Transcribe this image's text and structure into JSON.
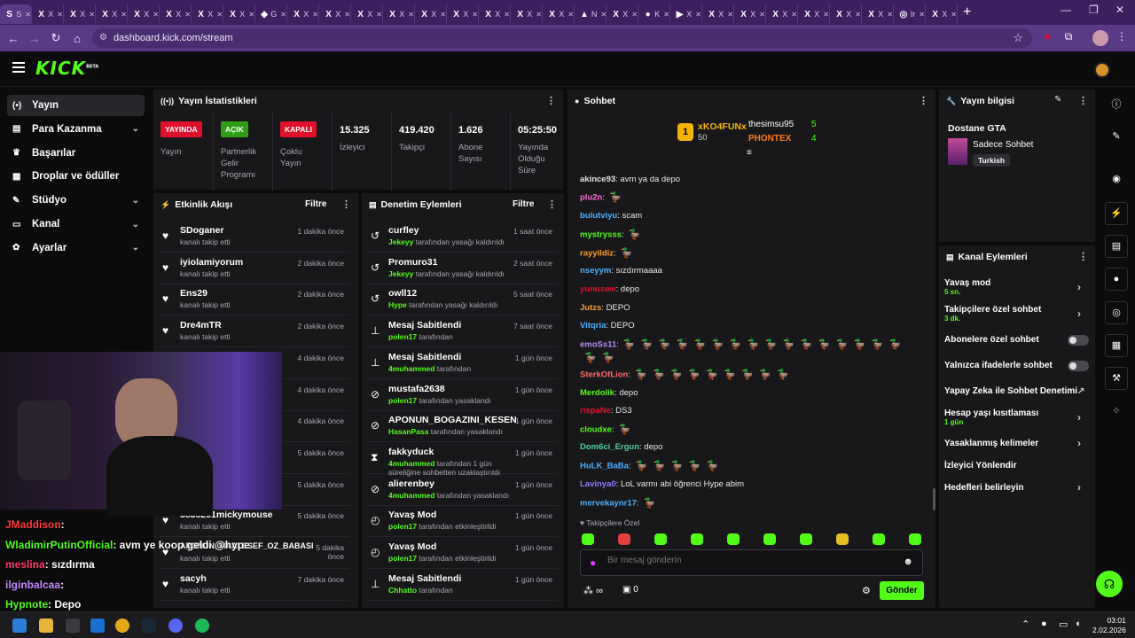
{
  "browser": {
    "tabs": [
      {
        "label": "S",
        "icon": "S"
      },
      {
        "label": "X",
        "icon": "X"
      },
      {
        "label": "X",
        "icon": "X"
      },
      {
        "label": "X",
        "icon": "X"
      },
      {
        "label": "X",
        "icon": "X"
      },
      {
        "label": "X",
        "icon": "X"
      },
      {
        "label": "X",
        "icon": "X"
      },
      {
        "label": "X",
        "icon": "X"
      },
      {
        "label": "G",
        "icon": "◆"
      },
      {
        "label": "X",
        "icon": "X"
      },
      {
        "label": "X",
        "icon": "X"
      },
      {
        "label": "X",
        "icon": "X"
      },
      {
        "label": "X",
        "icon": "X"
      },
      {
        "label": "X",
        "icon": "X"
      },
      {
        "label": "X",
        "icon": "X"
      },
      {
        "label": "X",
        "icon": "X"
      },
      {
        "label": "X",
        "icon": "X"
      },
      {
        "label": "X",
        "icon": "X"
      },
      {
        "label": "N",
        "icon": "▲"
      },
      {
        "label": "X",
        "icon": "X"
      },
      {
        "label": "K",
        "icon": "●"
      },
      {
        "label": "X",
        "icon": "▶"
      },
      {
        "label": "X",
        "icon": "X"
      },
      {
        "label": "X",
        "icon": "X"
      },
      {
        "label": "X",
        "icon": "X"
      },
      {
        "label": "X",
        "icon": "X"
      },
      {
        "label": "X",
        "icon": "X"
      },
      {
        "label": "X",
        "icon": "X"
      },
      {
        "label": "Ir",
        "icon": "◎"
      },
      {
        "label": "X",
        "icon": "X"
      }
    ],
    "url": "dashboard.kick.com/stream"
  },
  "brand": {
    "logo": "KICK",
    "beta": "BETA"
  },
  "sidebar": [
    {
      "label": "Yayın",
      "icon": "(•)",
      "active": true
    },
    {
      "label": "Para Kazanma",
      "icon": "▤",
      "chev": true
    },
    {
      "label": "Başarılar",
      "icon": "♛"
    },
    {
      "label": "Droplar ve ödüller",
      "icon": "▦"
    },
    {
      "label": "Stüdyo",
      "icon": "✎",
      "chev": true
    },
    {
      "label": "Kanal",
      "icon": "▭",
      "chev": true
    },
    {
      "label": "Ayarlar",
      "icon": "✿",
      "chev": true
    }
  ],
  "stats": {
    "title": "Yayın İstatistikleri",
    "items": [
      {
        "badge": "YAYINDA",
        "badge_color": "#e0102a",
        "label": "Yayın"
      },
      {
        "badge": "AÇIK",
        "badge_color": "#2f9e16",
        "label": "Partnerlik Gelir Programı"
      },
      {
        "badge": "KAPALI",
        "badge_color": "#e0102a",
        "label": "Çoklu Yayın"
      },
      {
        "value": "15.325",
        "label": "İzleyici"
      },
      {
        "value": "419.420",
        "label": "Takipçi"
      },
      {
        "value": "1.626",
        "label": "Abone Sayısı"
      },
      {
        "value": "05:25:50",
        "label": "Yayında Olduğu Süre"
      }
    ]
  },
  "activity": {
    "title": "Etkinlik Akışı",
    "filter": "Filtre",
    "items": [
      {
        "name": "SDoganer",
        "sub": "kanalı takip etti",
        "time": "1 dakika önce"
      },
      {
        "name": "iyiolamiyorum",
        "sub": "kanalı takip etti",
        "time": "2 dakika önce"
      },
      {
        "name": "Ens29",
        "sub": "kanalı takip etti",
        "time": "2 dakika önce"
      },
      {
        "name": "Dre4mTR",
        "sub": "kanalı takip etti",
        "time": "2 dakika önce"
      },
      {
        "name": "",
        "sub": "",
        "time": "4 dakika önce"
      },
      {
        "name": "",
        "sub": "",
        "time": "4 dakika önce"
      },
      {
        "name": "",
        "sub": "",
        "time": "4 dakika önce"
      },
      {
        "name": "",
        "sub": "",
        "time": "5 dakika önce"
      },
      {
        "name": "",
        "sub": "",
        "time": "5 dakika önce"
      },
      {
        "name": "5838291mickymouse",
        "sub": "kanalı takip etti",
        "time": "5 dakika önce"
      },
      {
        "name": "APONUN_MAALESEF_OZ_BABASI",
        "sub": "kanalı takip etti",
        "time": "5 dakika önce"
      },
      {
        "name": "sacyh",
        "sub": "kanalı takip etti",
        "time": "7 dakika önce"
      }
    ]
  },
  "moderation": {
    "title": "Denetim Eylemleri",
    "filter": "Filtre",
    "items": [
      {
        "icon": "↺",
        "name": "curfley",
        "by": "Jekeyy",
        "sub": " tarafından yasağı kaldırıldı",
        "time": "1 saat önce"
      },
      {
        "icon": "↺",
        "name": "Promuro31",
        "by": "Jekeyy",
        "sub": " tarafından yasağı kaldırıldı",
        "time": "2 saat önce"
      },
      {
        "icon": "↺",
        "name": "owll12",
        "by": "Hype",
        "sub": " tarafından yasağı kaldırıldı",
        "time": "5 saat önce"
      },
      {
        "icon": "⊥",
        "name": "Mesaj Sabitlendi",
        "by": "polen17",
        "sub": " tarafından",
        "time": "7 saat önce"
      },
      {
        "icon": "⊥",
        "name": "Mesaj Sabitlendi",
        "by": "4muhammed",
        "sub": " tarafından",
        "time": "1 gün önce"
      },
      {
        "icon": "⊘",
        "name": "mustafa2638",
        "by": "polen17",
        "sub": " tarafından yasaklandı",
        "time": "1 gün önce"
      },
      {
        "icon": "⊘",
        "name": "APONUN_BOGAZINI_KESEN",
        "by": "HasanPasa",
        "sub": " tarafından yasaklandı",
        "time": "1 gün önce"
      },
      {
        "icon": "⧗",
        "name": "fakkyduck",
        "by": "4muhammed",
        "sub": " tarafından 1 gün süreliğine sohbetten uzaklaştırıldı",
        "time": "1 gün önce"
      },
      {
        "icon": "⊘",
        "name": "alierenbey",
        "by": "4muhammed",
        "sub": " tarafından yasaklandı",
        "time": "1 gün önce"
      },
      {
        "icon": "◴",
        "name": "Yavaş Mod",
        "by": "polen17",
        "sub": " tarafından etkinleştirildi",
        "time": "1 gün önce"
      },
      {
        "icon": "◴",
        "name": "Yavaş Mod",
        "by": "polen17",
        "sub": " tarafından etkinleştirildi",
        "time": "1 gün önce"
      },
      {
        "icon": "⊥",
        "name": "Mesaj Sabitlendi",
        "by": "Chhatto",
        "sub": " tarafından",
        "time": "1 gün önce"
      }
    ]
  },
  "chat": {
    "title": "Sohbet",
    "leaders": [
      {
        "rank": "1",
        "name": "xKO4FUNx",
        "count": "50"
      },
      {
        "name": "thesimsu95",
        "count": "5"
      },
      {
        "name": "PHONTEX",
        "count": "4"
      }
    ],
    "messages": [
      {
        "user": "akince93",
        "color": "#e0e0e0",
        "text": ": avm ya da depo"
      },
      {
        "user": "plu2n",
        "color": "#ff6ad5",
        "text": ":",
        "emotes": 1
      },
      {
        "user": "bulutviyu",
        "color": "#4ab0ff",
        "text": ": scam"
      },
      {
        "user": "mystrysss",
        "color": "#53fc18",
        "text": ":",
        "emotes": 1
      },
      {
        "user": "rayyildiz",
        "color": "#ff9d2e",
        "text": ":",
        "emotes": 1
      },
      {
        "user": "nseyym",
        "color": "#4ab0ff",
        "text": ": sızdırmaaaa"
      },
      {
        "user": "yunuswe",
        "color": "#e0102a",
        "text": ": depo"
      },
      {
        "user": "Jutzs",
        "color": "#ff9d2e",
        "text": ": DEPO"
      },
      {
        "user": "Vitqria",
        "color": "#4ab0ff",
        "text": ": DEPO"
      },
      {
        "user": "emoSs11",
        "color": "#b78bff",
        "text": ":",
        "emotes": 16
      },
      {
        "user": "",
        "color": "#fff",
        "text": "",
        "emotes": 2
      },
      {
        "user": "SterkOfLion",
        "color": "#ff6a6a",
        "text": ":",
        "emotes": 9
      },
      {
        "user": "Merdolik",
        "color": "#53fc18",
        "text": ": depo"
      },
      {
        "user": "rispaNe",
        "color": "#e0102a",
        "text": ": DS3"
      },
      {
        "user": "cloudxe",
        "color": "#53fc18",
        "text": ":",
        "emotes": 1
      },
      {
        "user": "Dom6ci_Ergun",
        "color": "#4ad0a0",
        "text": ": depo"
      },
      {
        "user": "HuLK_BaBa",
        "color": "#4ab0ff",
        "text": ":",
        "emotes": 5
      },
      {
        "user": "Lavinya0",
        "color": "#8a7bff",
        "text": ": LoL varmı abi öğrenci Hype abim"
      },
      {
        "user": "mervekaynr17",
        "color": "#4ab0ff",
        "text": ":",
        "emotes": 1
      }
    ],
    "followers_only": "Takipçilere Özel",
    "placeholder": "Bir mesaj gönderin",
    "infinite": "∞",
    "count": "0",
    "send": "Gönder"
  },
  "stream_info": {
    "title": "Yayın bilgisi",
    "game": "Dostane GTA",
    "category": "Sadece Sohbet",
    "tag": "Turkish"
  },
  "channel_actions": {
    "title": "Kanal Eylemleri",
    "items": [
      {
        "label": "Yavaş mod",
        "sub": "5 sn.",
        "type": "chev"
      },
      {
        "label": "Takipçilere özel sohbet",
        "sub": "3 dk.",
        "type": "chev"
      },
      {
        "label": "Abonelere özel sohbet",
        "type": "toggle"
      },
      {
        "label": "Yalnızca ifadelerle sohbet",
        "type": "toggle"
      },
      {
        "label": "Yapay Zeka ile Sohbet Denetimi",
        "type": "ext"
      },
      {
        "label": "Hesap yaşı kısıtlaması",
        "sub": "1 gün",
        "type": "chev"
      },
      {
        "label": "Yasaklanmış kelimeler",
        "type": "chev"
      },
      {
        "label": "İzleyici Yönlendir",
        "type": "none"
      },
      {
        "label": "Hedefleri belirleyin",
        "type": "chev"
      }
    ]
  },
  "overlay_chat": [
    {
      "user": "JMaddison",
      "color": "#ff3a3a",
      "text": ":"
    },
    {
      "user": "WladimirPutinOfficial",
      "color": "#53fc18",
      "text": ": avm ye koop geldi @hype"
    },
    {
      "user": "meslina",
      "color": "#ff3a6a",
      "text": ": sızdırma"
    },
    {
      "user": "ilginbalcaa",
      "color": "#c58bff",
      "text": ":"
    },
    {
      "user": "Hypnote",
      "color": "#53fc18",
      "text": ": Depo"
    }
  ],
  "clock": {
    "time": "03:01",
    "date": "2.02.2026"
  }
}
